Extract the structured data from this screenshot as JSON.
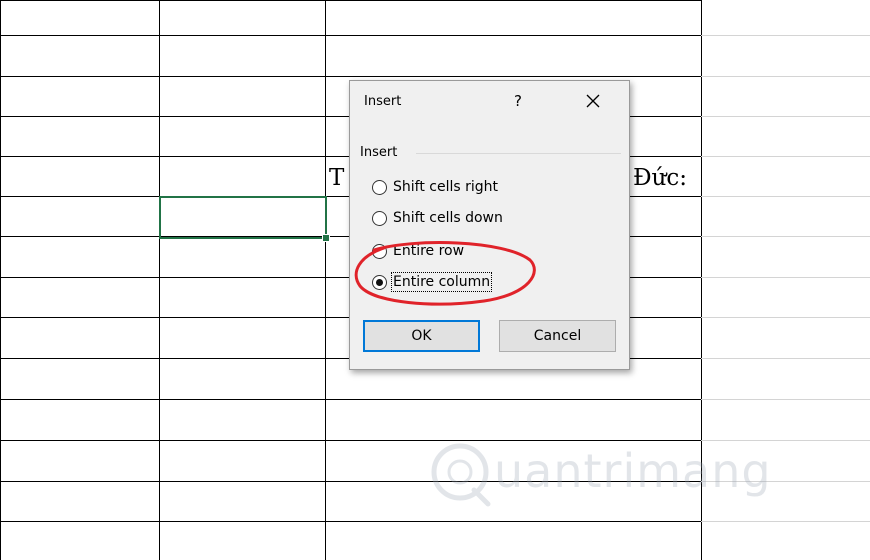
{
  "sheet": {
    "cell_text_left": "T",
    "cell_text_right": "Đức:"
  },
  "dialog": {
    "title": "Insert",
    "help_label": "?",
    "close_label": "✕",
    "group_label": "Insert",
    "options": [
      {
        "label": "Shift cells right",
        "checked": false
      },
      {
        "label": "Shift cells down",
        "checked": false
      },
      {
        "label": "Entire row",
        "checked": false
      },
      {
        "label": "Entire column",
        "checked": true
      }
    ],
    "ok_label": "OK",
    "cancel_label": "Cancel"
  },
  "annotation": {
    "color": "#e0232a"
  },
  "watermark": {
    "text": "uantrimang"
  },
  "colors": {
    "selection": "#217346",
    "dialog_bg": "#f0f0f0",
    "ok_border": "#0078d7"
  }
}
